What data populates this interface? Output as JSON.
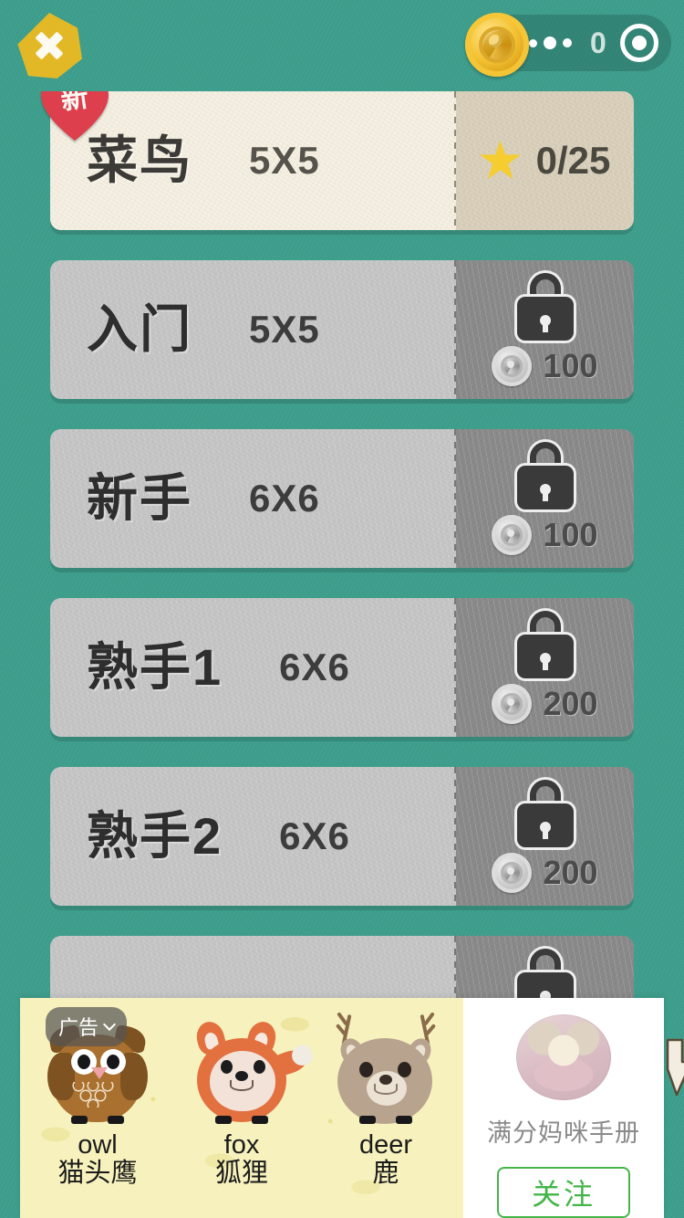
{
  "top_bar": {
    "close_label": "×",
    "close_icon": "close-x-icon",
    "coin_icon": "gold-coin-icon",
    "coin_amount": "0",
    "add_icon": "add-coin-icon"
  },
  "levels": [
    {
      "name": "菜鸟",
      "grid": "5X5",
      "state": "unlocked",
      "badge": "新",
      "star_icon": "gold-star-icon",
      "progress": "0/25"
    },
    {
      "name": "入门",
      "grid": "5X5",
      "state": "locked",
      "lock_icon": "padlock-icon",
      "coin_icon": "silver-coin-icon",
      "price": "100"
    },
    {
      "name": "新手",
      "grid": "6X6",
      "state": "locked",
      "lock_icon": "padlock-icon",
      "coin_icon": "silver-coin-icon",
      "price": "100"
    },
    {
      "name": "熟手1",
      "grid": "6X6",
      "state": "locked",
      "lock_icon": "padlock-icon",
      "coin_icon": "silver-coin-icon",
      "price": "200"
    },
    {
      "name": "熟手2",
      "grid": "6X6",
      "state": "locked",
      "lock_icon": "padlock-icon",
      "coin_icon": "silver-coin-icon",
      "price": "200"
    },
    {
      "name": "",
      "grid": "",
      "state": "locked",
      "lock_icon": "padlock-icon",
      "coin_icon": "silver-coin-icon",
      "price": ""
    }
  ],
  "ad": {
    "label": "广告",
    "label_icon": "chevron-down-icon",
    "animals": [
      {
        "art": "owl-illustration",
        "en": "owl",
        "cn": "猫头鹰"
      },
      {
        "art": "fox-illustration",
        "en": "fox",
        "cn": "狐狸"
      },
      {
        "art": "deer-illustration",
        "en": "deer",
        "cn": "鹿"
      }
    ],
    "promo": {
      "avatar": "baby-photo-avatar",
      "title": "满分妈咪手册",
      "follow_label": "关注"
    },
    "cursor_icon": "hand-cursor-icon"
  },
  "colors": {
    "background": "#3d9e8c",
    "accent_gold": "#e3b827",
    "unlocked_card": "#f4efe1",
    "unlocked_card_side": "#d9cfba",
    "locked_card": "#c6c6c6",
    "locked_card_side": "#8a8a8a",
    "badge_red": "#dd3f4c",
    "star_gold": "#f5cd31",
    "ad_background": "#f7f2bd",
    "follow_green": "#44b549"
  }
}
